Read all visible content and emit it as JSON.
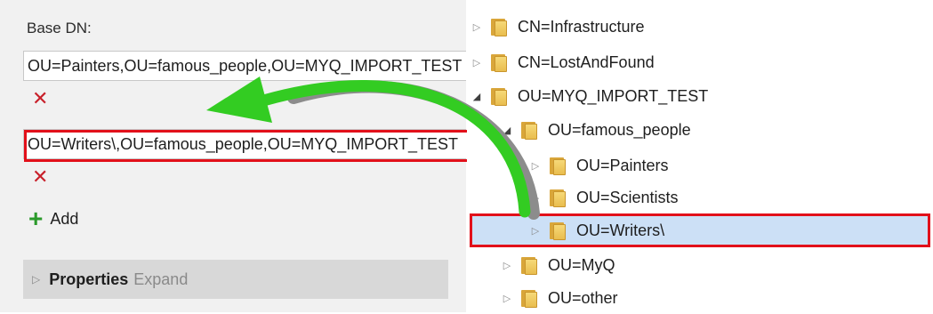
{
  "left": {
    "base_dn_label": "Base DN:",
    "fields": [
      "OU=Painters,OU=famous_people,OU=MYQ_IMPORT_TEST",
      "OU=Writers\\,OU=famous_people,OU=MYQ_IMPORT_TEST"
    ],
    "remove_icon": "x-icon",
    "add_label": "Add",
    "properties_label": "Properties",
    "expand_label": "Expand"
  },
  "tree": {
    "items": [
      {
        "label": "CN=Infrastructure",
        "expanded": false
      },
      {
        "label": "CN=LostAndFound",
        "expanded": false
      },
      {
        "label": "OU=MYQ_IMPORT_TEST",
        "expanded": true
      },
      {
        "label": "OU=famous_people",
        "expanded": true
      },
      {
        "label": "OU=Painters",
        "expanded": false
      },
      {
        "label": "OU=Scientists",
        "expanded": false
      },
      {
        "label": "OU=Writers\\",
        "expanded": false,
        "selected": true
      },
      {
        "label": "OU=MyQ",
        "expanded": false
      },
      {
        "label": "OU=other",
        "expanded": false
      }
    ]
  },
  "colors": {
    "highlight": "#e2101a",
    "selection": "#cce0f6",
    "arrow_green": "#33cc22",
    "arrow_gray": "#8c8c8c"
  }
}
